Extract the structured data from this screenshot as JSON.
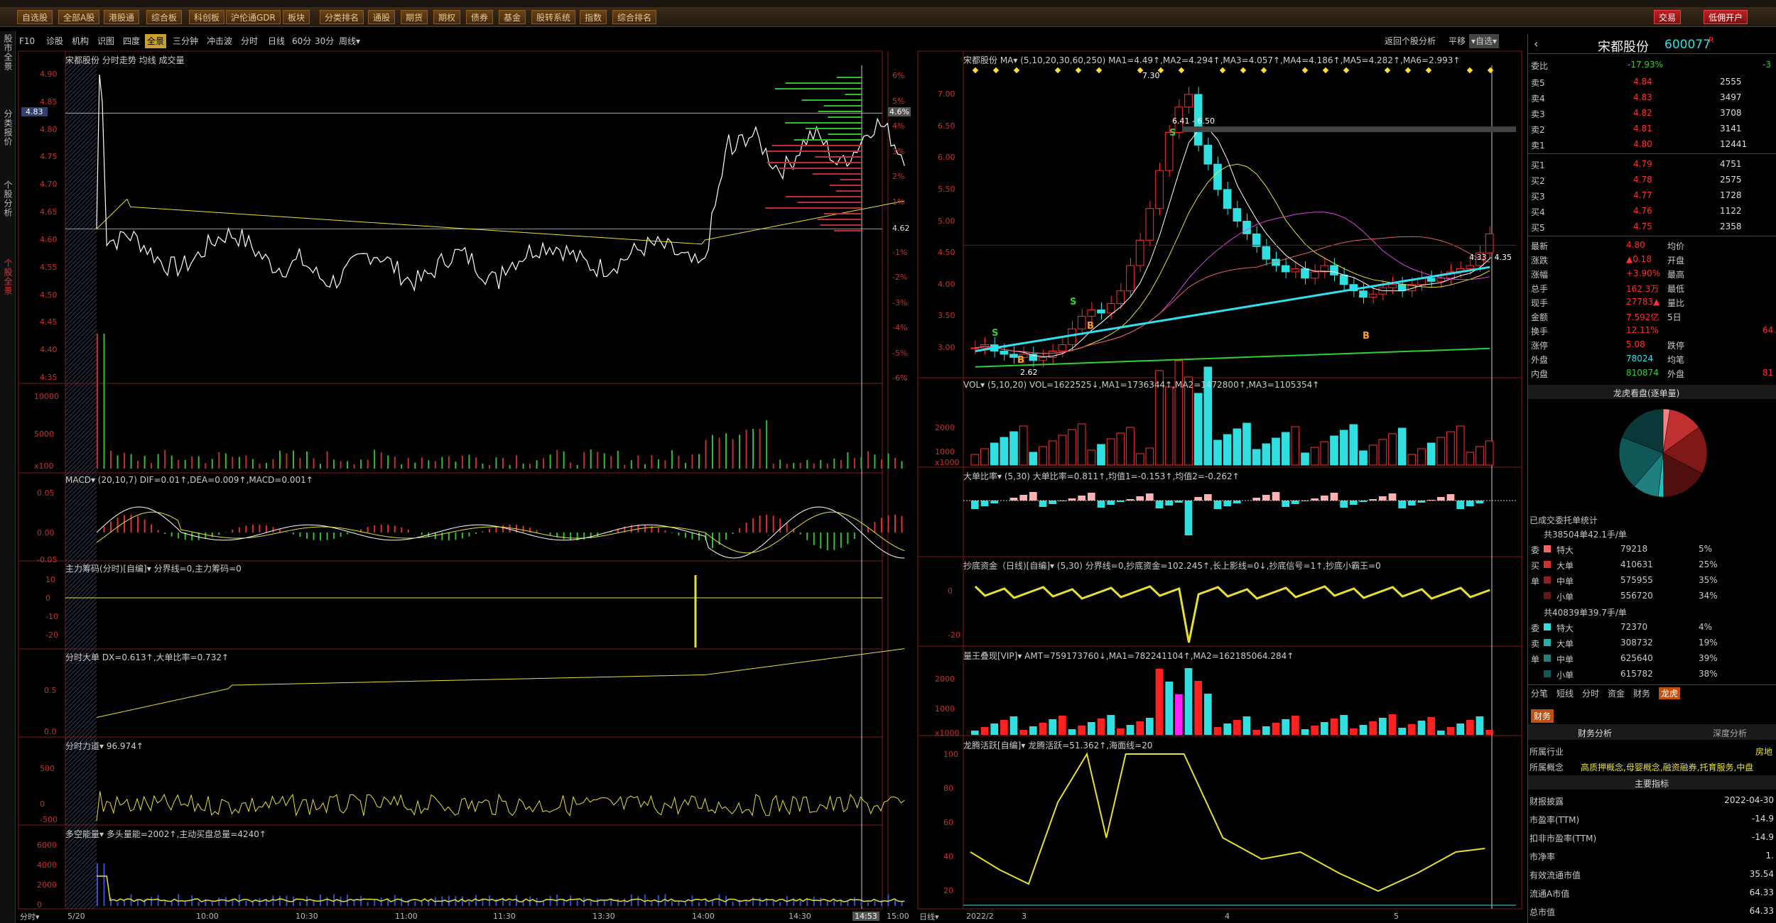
{
  "toolbar": {
    "buttons": [
      "自选股",
      "全部A股",
      "港股通",
      "综合板",
      "科创板",
      "沪伦通GDR",
      "板块",
      "分类排名",
      "通股",
      "期货",
      "期权",
      "债券",
      "基金",
      "股转系统",
      "指数",
      "综合排名"
    ],
    "trade": "交易",
    "open_account": "低佣开户"
  },
  "leftbar": {
    "items": [
      "股市全景",
      "分类报价",
      "个股分析",
      "个股全景"
    ]
  },
  "subtoolbar": {
    "items": [
      "F10",
      "诊股",
      "机构",
      "识图",
      "四度",
      "全景",
      "三分钟",
      "冲击波",
      "分时",
      "日线",
      "60分",
      "30分",
      "周线▾"
    ],
    "active": "全景",
    "right_items": [
      "返回个股分析",
      "平移",
      "▾自选▾"
    ]
  },
  "intraday": {
    "title": "宋都股份 分时走势 均线 成交量",
    "price_ticks": [
      "4.90",
      "4.85",
      "4.80",
      "4.75",
      "4.70",
      "4.65",
      "4.60",
      "4.55",
      "4.50",
      "4.45",
      "4.40",
      "4.35"
    ],
    "pct_ticks": [
      "6%",
      "5%",
      "4%",
      "3%",
      "2%",
      "1%",
      "",
      "-1%",
      "-2%",
      "-3%",
      "-4%",
      "-5%",
      "-6%"
    ],
    "current_price_tag": "4.83",
    "current_pct_tag": "4.6%",
    "prev_close": "4.62",
    "vol_ticks": [
      "10000",
      "5000",
      "x100"
    ],
    "macd_title": "MACD▾ (20,10,7) DIF=0.01↑,DEA=0.009↑,MACD=0.001↑",
    "macd_ticks": [
      "0.05",
      "0.00",
      "-0.05"
    ],
    "zhuli_title": "主力筹码(分时)[自编]▾ 分界线=0,主力筹码=0",
    "zhuli_ticks": [
      "10",
      "0",
      "-10",
      "-20"
    ],
    "dadan_title": "分时大单 DX=0.613↑,大单比率=0.732↑",
    "dadan_ticks": [
      "0.5",
      "0.0"
    ],
    "lidao_title": "分时力道▾ 96.974↑",
    "lidao_ticks": [
      "500",
      "0",
      "-500"
    ],
    "duokong_title": "多空能量▾ 多头量能=2002↑,主动买盘总量=4240↑",
    "duokong_ticks": [
      "6000",
      "4000",
      "2000",
      "0"
    ],
    "time_labels": [
      "5/20",
      "10:00",
      "10:30",
      "11:00",
      "11:30",
      "13:30",
      "14:00",
      "14:30",
      "14:53",
      "15:00"
    ],
    "time_prefix": "分时▾"
  },
  "daily": {
    "title": "宋都股份 MA▾ (5,10,20,30,60,250) MA1=4.49↑,MA2=4.294↑,MA3=4.057↑,MA4=4.186↑,MA5=4.282↑,MA6=2.993↑",
    "price_ticks": [
      "7.00",
      "6.50",
      "6.00",
      "5.50",
      "5.00",
      "4.50",
      "4.00",
      "3.50",
      "3.00"
    ],
    "annotations": [
      "7.30",
      "6.41 - 6.50",
      "4.33 - 4.35",
      "2.62"
    ],
    "vol_title": "VOL▾ (5,10,20) VOL=1622525↓,MA1=1736344↑,MA2=1472800↑,MA3=1105354↑",
    "vol_ticks": [
      "2000",
      "1000",
      "x1000"
    ],
    "dadan_title": "大单比率▾ (5,30) 大单比率=0.811↑,均值1=-0.153↑,均值2=-0.262↑",
    "chaodi_title": "抄底资金（日线)[自编]▾ (5,30) 分界线=0,抄底资金=102.245↑,长上影线=0↓,抄底信号=1↑,抄底小霸王=0",
    "chaodi_ticks": [
      "0",
      "-20"
    ],
    "liangwang_title": "量王叠现[VIP]▾ AMT=759173760↓,MA1=782241104↑,MA2=1621850​64.284↑",
    "liangwang_ticks": [
      "2000",
      "1000",
      "x1000"
    ],
    "longteng_title": "龙腾活跃[自编]▾ 龙腾活跃=51.362↑,海面线=20",
    "longteng_ticks": [
      "100",
      "80",
      "60",
      "40",
      "20"
    ],
    "time_labels": [
      "2022/2",
      "3",
      "4",
      "5"
    ],
    "time_prefix": "日线▾"
  },
  "quote": {
    "name": "宋都股份",
    "code": "600077",
    "flag": "R",
    "weibi_label": "委比",
    "weibi": "-17.93%",
    "weicha": "-3",
    "sell": [
      [
        "卖5",
        "4.84",
        "2555"
      ],
      [
        "卖4",
        "4.83",
        "3497"
      ],
      [
        "卖3",
        "4.82",
        "3708"
      ],
      [
        "卖2",
        "4.81",
        "3141"
      ],
      [
        "卖1",
        "4.80",
        "12441"
      ]
    ],
    "buy": [
      [
        "买1",
        "4.79",
        "4751"
      ],
      [
        "买2",
        "4.78",
        "2575"
      ],
      [
        "买3",
        "4.77",
        "1728"
      ],
      [
        "买4",
        "4.76",
        "1122"
      ],
      [
        "买5",
        "4.75",
        "2358"
      ]
    ],
    "stats": [
      [
        "最新",
        "4.80",
        "均价",
        ""
      ],
      [
        "涨跌",
        "▲0.18",
        "开盘",
        ""
      ],
      [
        "涨幅",
        "+3.90%",
        "最高",
        ""
      ],
      [
        "总手",
        "162.3万",
        "最低",
        ""
      ],
      [
        "现手",
        "27783▲",
        "量比",
        ""
      ],
      [
        "金额",
        "7.592亿",
        "5日",
        ""
      ],
      [
        "换手",
        "12.11%",
        "",
        "64."
      ],
      [
        "涨停",
        "5.08",
        "跌停",
        ""
      ],
      [
        "外盘",
        "78024",
        "均笔",
        ""
      ],
      [
        "内盘",
        "810874",
        "外盘",
        "81"
      ]
    ],
    "lhb_title": "龙虎看盘(逐单量)",
    "deal_title": "已成交委托单统计",
    "buy_total": "共38504单42.1手/单",
    "buy_rows": [
      [
        "特大",
        "79218",
        "5%"
      ],
      [
        "大单",
        "410631",
        "25%"
      ],
      [
        "中单",
        "575955",
        "35%"
      ],
      [
        "小单",
        "556720",
        "34%"
      ]
    ],
    "sell_total": "共40839单39.7手/单",
    "sell_rows": [
      [
        "特大",
        "72370",
        "4%"
      ],
      [
        "大单",
        "308732",
        "19%"
      ],
      [
        "中单",
        "625640",
        "39%"
      ],
      [
        "小单",
        "615782",
        "38%"
      ]
    ],
    "tabs": [
      "分笔",
      "短线",
      "分时",
      "资金",
      "财务",
      "龙虎"
    ],
    "active_tab": "龙虎",
    "fin_tab": "财务",
    "fin_subtabs": [
      "财务分析",
      "深度分析"
    ],
    "industry_label": "所属行业",
    "industry": "房地",
    "concept_label": "所属概念",
    "concept": "高质押概念,母婴概念,融资融券,托育服务,中盘",
    "main_index": "主要指标",
    "fin_rows": [
      [
        "财报披露",
        "2022-04-30"
      ],
      [
        "市盈率(TTM)",
        "-14.9"
      ],
      [
        "扣非市盈率(TTM)",
        "-14.9"
      ],
      [
        "市净率",
        "1."
      ],
      [
        "有效流通市值",
        "35.54"
      ],
      [
        "流通A市值",
        "64.33"
      ],
      [
        "总市值",
        "64.33"
      ]
    ]
  },
  "colors": {
    "up": "#ff3030",
    "down": "#30e0e0",
    "ma_yellow": "#e8e030",
    "panel_border": "#801818"
  }
}
